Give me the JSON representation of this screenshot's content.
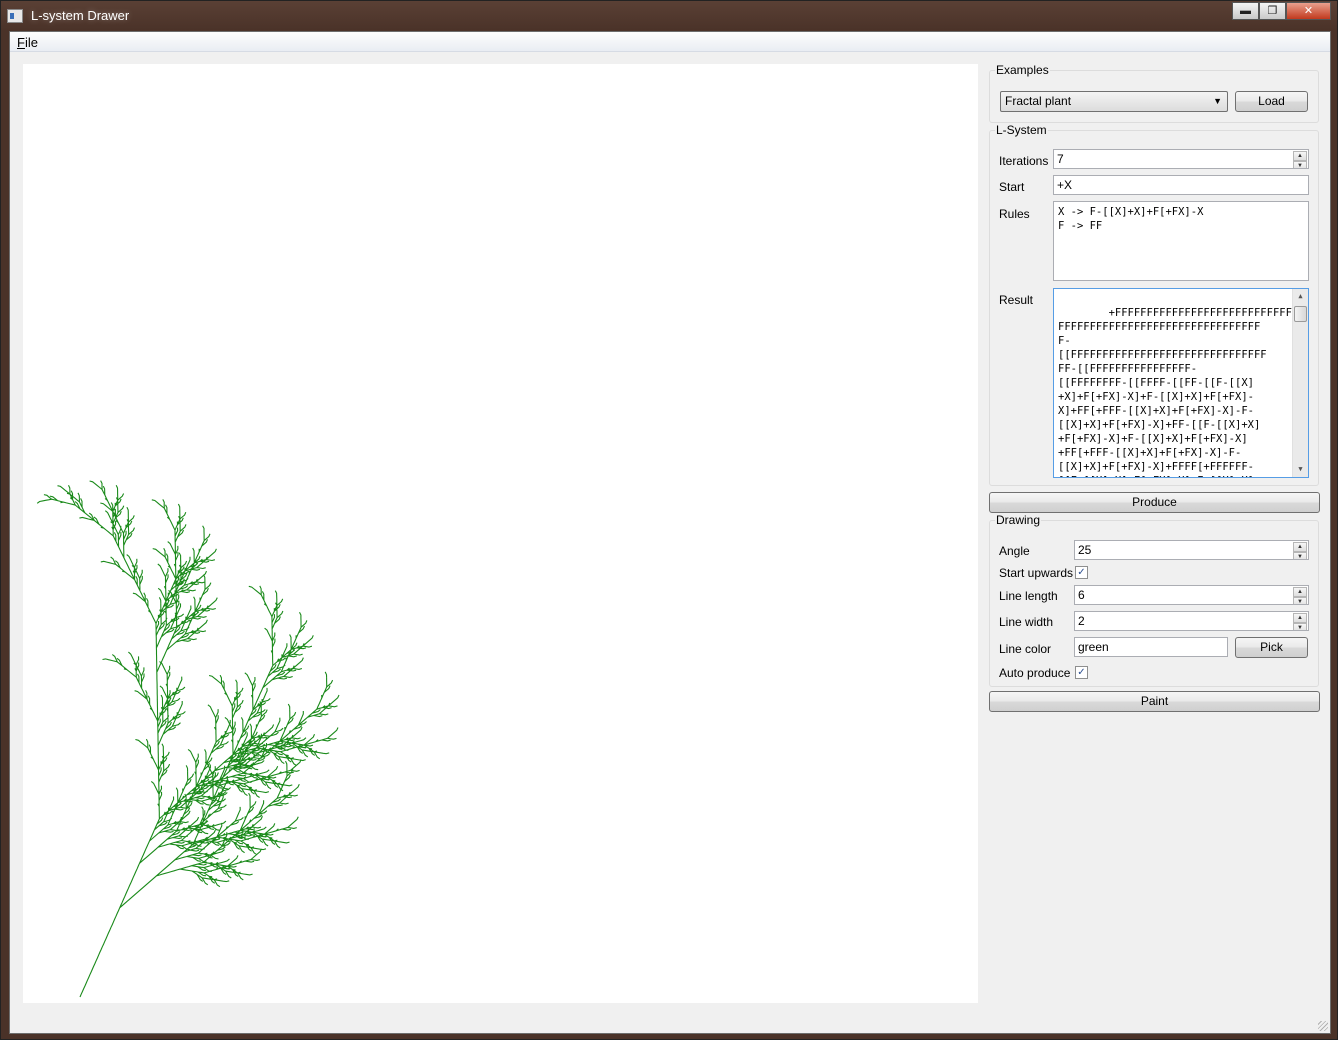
{
  "window": {
    "title": "L-system Drawer"
  },
  "titlebar_buttons": {
    "minimize": "▬",
    "maximize": "❐",
    "close": "✕"
  },
  "menu": {
    "file": {
      "label_underlined": "F",
      "label_rest": "ile"
    }
  },
  "canvas": {
    "line_color": "#1a8a1a"
  },
  "examples": {
    "title": "Examples",
    "selected": "Fractal plant",
    "load_label": "Load"
  },
  "lsystem": {
    "title": "L-System",
    "iterations_label": "Iterations",
    "iterations": "7",
    "start_label": "Start",
    "start": "+X",
    "rules_label": "Rules",
    "rules": "X -> F-[[X]+X]+F[+FX]-X\nF -> FF",
    "result_label": "Result",
    "result": "+FFFFFFFFFFFFFFFFFFFFFFFFFFFFFFFF\nFFFFFFFFFFFFFFFFFFFFFFFFFFFFFFFF\nF-\n[[FFFFFFFFFFFFFFFFFFFFFFFFFFFFFFF\nFF-[[FFFFFFFFFFFFFFFF-\n[[FFFFFFFF-[[FFFF-[[FF-[[F-[[X]\n+X]+F[+FX]-X]+F-[[X]+X]+F[+FX]-\nX]+FF[+FFF-[[X]+X]+F[+FX]-X]-F-\n[[X]+X]+F[+FX]-X]+FF-[[F-[[X]+X]\n+F[+FX]-X]+F-[[X]+X]+F[+FX]-X]\n+FF[+FFF-[[X]+X]+F[+FX]-X]-F-\n[[X]+X]+F[+FX]-X]+FFFF[+FFFFFF-\n[[F-[[X]+X]+F[+FX]-X]+F-[[X]+X]"
  },
  "produce_label": "Produce",
  "drawing": {
    "title": "Drawing",
    "angle_label": "Angle",
    "angle": "25",
    "start_upwards_label": "Start upwards",
    "start_upwards": true,
    "line_length_label": "Line length",
    "line_length": "6",
    "line_width_label": "Line width",
    "line_width": "2",
    "line_color_label": "Line color",
    "line_color": "green",
    "pick_label": "Pick",
    "auto_produce_label": "Auto produce",
    "auto_produce": true
  },
  "paint_label": "Paint",
  "spin": {
    "up": "▲",
    "down": "▼"
  },
  "combo_arrow": "▼",
  "checkmark": "✓"
}
